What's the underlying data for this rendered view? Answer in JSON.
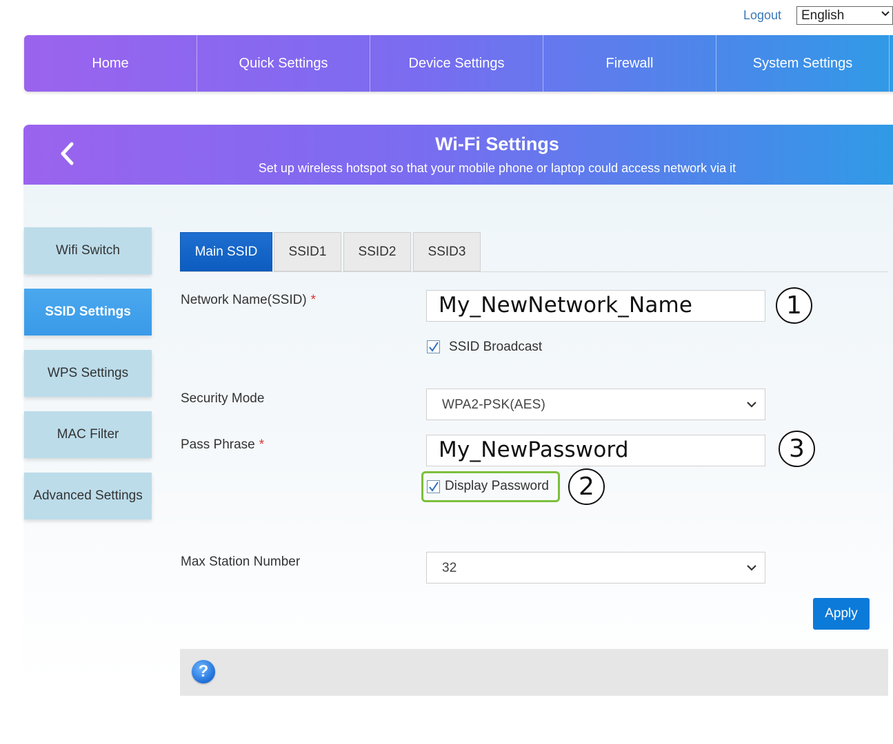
{
  "top": {
    "logout": "Logout",
    "language": "English"
  },
  "nav": {
    "items": [
      "Home",
      "Quick Settings",
      "Device Settings",
      "Firewall",
      "System Settings"
    ]
  },
  "header": {
    "title": "Wi-Fi Settings",
    "subtitle": "Set up wireless hotspot so that your mobile phone or laptop could access network via it"
  },
  "sidebar": {
    "items": [
      "Wifi Switch",
      "SSID Settings",
      "WPS Settings",
      "MAC Filter",
      "Advanced Settings"
    ],
    "active": "SSID Settings"
  },
  "tabs": {
    "items": [
      "Main SSID",
      "SSID1",
      "SSID2",
      "SSID3"
    ],
    "active": "Main SSID"
  },
  "form": {
    "ssid_label": "Network Name(SSID)",
    "required_mark": "*",
    "ssid_value": "My_NewNetwork_Name",
    "ssid_broadcast_label": "SSID Broadcast",
    "ssid_broadcast_checked": true,
    "security_label": "Security Mode",
    "security_value": "WPA2-PSK(AES)",
    "pass_label": "Pass Phrase",
    "pass_value": "My_NewPassword",
    "display_password_label": "Display Password",
    "display_password_checked": true,
    "max_station_label": "Max Station Number",
    "max_station_value": "32",
    "apply_label": "Apply"
  },
  "annotations": {
    "step1": "1",
    "step2": "2",
    "step3": "3"
  },
  "help": {
    "icon_text": "?"
  },
  "colors": {
    "nav_gradient_start": "#9b63ee",
    "nav_gradient_end": "#2f9be6",
    "active_tab": "#0d5cc0",
    "sidebar_active": "#3a9ae8",
    "sidebar_item": "#bcdcea",
    "highlight": "#7cbf3c",
    "apply": "#0c7ad8"
  }
}
